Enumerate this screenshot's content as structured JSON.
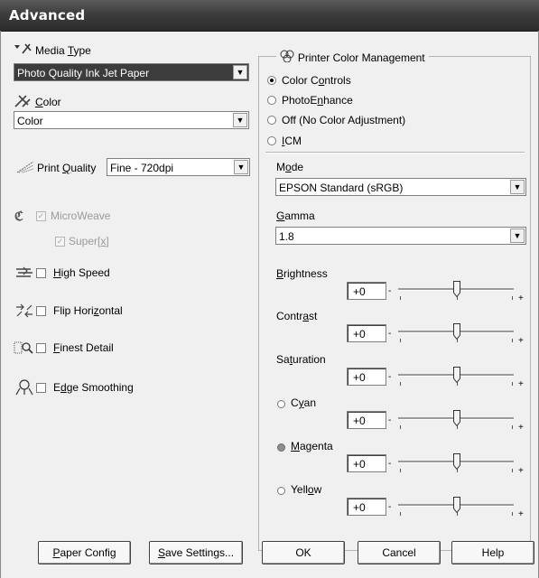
{
  "window": {
    "title": "Advanced"
  },
  "left": {
    "media_type": {
      "label": "Media Type",
      "value": "Photo Quality Ink Jet Paper",
      "icon": "media-type-icon"
    },
    "color": {
      "label": "Color",
      "value": "Color",
      "icon": "color-icon"
    },
    "print_quality": {
      "label": "Print Quality",
      "value": "Fine - 720dpi",
      "icon": "print-quality-icon"
    },
    "microweave": {
      "label": "MicroWeave",
      "checked": true,
      "disabled": true
    },
    "super": {
      "label": "Super",
      "checked": true,
      "disabled": true
    },
    "high_speed": {
      "label": "High Speed",
      "checked": false
    },
    "flip_horizontal": {
      "label": "Flip Horizontal",
      "checked": false
    },
    "finest_detail": {
      "label": "Finest Detail",
      "checked": false
    },
    "edge_smoothing": {
      "label": "Edge Smoothing",
      "checked": false
    }
  },
  "pcm": {
    "title": "Printer Color Management",
    "options": [
      "Color Controls",
      "PhotoEnhance",
      "Off (No Color Adjustment)",
      "ICM"
    ],
    "selected": "Color Controls",
    "mode": {
      "label": "Mode",
      "value": "EPSON Standard (sRGB)"
    },
    "gamma": {
      "label": "Gamma",
      "value": "1.8"
    },
    "sliders": [
      {
        "label": "Brightness",
        "value": "+0"
      },
      {
        "label": "Contrast",
        "value": "+0"
      },
      {
        "label": "Saturation",
        "value": "+0"
      },
      {
        "label": "Cyan",
        "value": "+0"
      },
      {
        "label": "Magenta",
        "value": "+0"
      },
      {
        "label": "Yellow",
        "value": "+0"
      }
    ],
    "minus": "-",
    "plus": "+"
  },
  "buttons": {
    "paper_config": "Paper Config",
    "save_settings": "Save Settings...",
    "ok": "OK",
    "cancel": "Cancel",
    "help": "Help"
  }
}
